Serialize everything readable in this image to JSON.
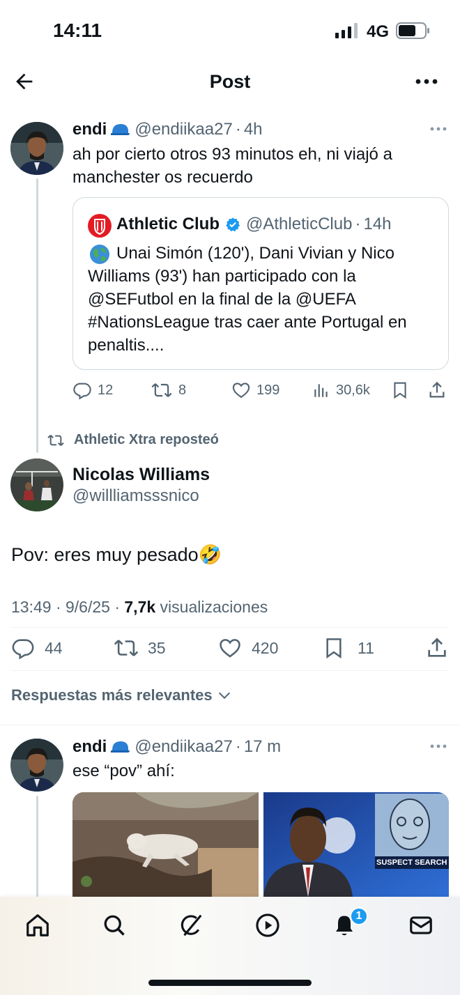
{
  "status_bar": {
    "time": "14:11",
    "network": "4G"
  },
  "header": {
    "title": "Post"
  },
  "quote_reply": {
    "author_name": "endi",
    "handle": "@endiikaa27",
    "time": "4h",
    "text": "ah por cierto otros 93 minutos eh, ni viajó a manchester os recuerdo",
    "quoted": {
      "author_name": "Athletic Club",
      "handle": "@AthleticClub",
      "time": "14h",
      "text": "Unai Simón (120'), Dani Vivian y Nico Williams (93') han participado con la @SEFutbol en la final de la @UEFA #NationsLeague tras caer ante Portugal en penaltis...."
    },
    "stats": {
      "replies": "12",
      "reposts": "8",
      "likes": "199",
      "views": "30,6k"
    }
  },
  "repost_label": "Athletic Xtra reposteó",
  "main_post": {
    "author_name": "Nicolas Williams",
    "handle": "@willliamsssnico",
    "text": "Pov: eres muy pesado🤣",
    "meta_time": "13:49 · 9/6/25 · ",
    "meta_views": "7,7k",
    "meta_views_label": " visualizaciones",
    "stats": {
      "replies": "44",
      "reposts": "35",
      "likes": "420",
      "bookmarks": "11"
    }
  },
  "replies_sort": {
    "label": "Respuestas más relevantes"
  },
  "reply": {
    "author_name": "endi",
    "handle": "@endiikaa27",
    "time": "17 m",
    "text": "ese “pov” ahí:",
    "media_caption": "SUSPECT SEARCH"
  },
  "bottom_nav": {
    "notifications_badge": "1"
  },
  "colors": {
    "accent": "#1d9bf0",
    "text": "#0f1419",
    "secondary": "#536471",
    "border": "#cfd9de"
  }
}
